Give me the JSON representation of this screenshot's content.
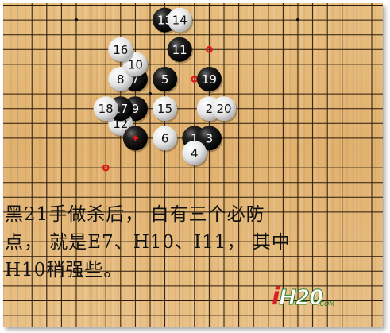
{
  "stones": [
    {
      "num": "1",
      "color": "black",
      "col": 13,
      "row": 9
    },
    {
      "num": "2",
      "color": "white",
      "col": 14,
      "row": 7
    },
    {
      "num": "3",
      "color": "black",
      "col": 14,
      "row": 9
    },
    {
      "num": "4",
      "color": "white",
      "col": 13,
      "row": 10
    },
    {
      "num": "5",
      "color": "black",
      "col": 11,
      "row": 5
    },
    {
      "num": "6",
      "color": "white",
      "col": 11,
      "row": 9
    },
    {
      "num": "7",
      "color": "black",
      "col": 9,
      "row": 5
    },
    {
      "num": "8",
      "color": "white",
      "col": 8,
      "row": 5
    },
    {
      "num": "9",
      "color": "black",
      "col": 9,
      "row": 7
    },
    {
      "num": "10",
      "color": "white",
      "col": 9,
      "row": 4
    },
    {
      "num": "11",
      "color": "black",
      "col": 12,
      "row": 3
    },
    {
      "num": "12",
      "color": "white",
      "col": 8,
      "row": 8
    },
    {
      "num": "13",
      "color": "black",
      "col": 11,
      "row": 1
    },
    {
      "num": "14",
      "color": "white",
      "col": 12,
      "row": 1
    },
    {
      "num": "15",
      "color": "white",
      "col": 11,
      "row": 7
    },
    {
      "num": "16",
      "color": "white",
      "col": 8,
      "row": 3
    },
    {
      "num": "17",
      "color": "black",
      "col": 8,
      "row": 7
    },
    {
      "num": "18",
      "color": "white",
      "col": 7,
      "row": 7
    },
    {
      "num": "19",
      "color": "black",
      "col": 14,
      "row": 5
    },
    {
      "num": "20",
      "color": "white",
      "col": 15,
      "row": 7
    },
    {
      "num": "",
      "color": "black",
      "col": 9,
      "row": 9,
      "last_move": true
    }
  ],
  "red_marks": [
    {
      "col": 14,
      "row": 3
    },
    {
      "col": 13,
      "row": 5
    },
    {
      "col": 7,
      "row": 11
    }
  ],
  "star_points": [
    {
      "col": 5,
      "row": 1
    },
    {
      "col": 10,
      "row": 6
    },
    {
      "col": 20,
      "row": 1
    }
  ],
  "caption": {
    "line1": "黑21手做杀后， 白有三个必防",
    "line2": "点， 就是E7、H10、I11， 其中",
    "line3": "H10稍强些。"
  },
  "logo": {
    "text": "iH20",
    "domain": ".COM"
  },
  "colors": {
    "grid": "#2a1a0a",
    "black_stone": "#111111",
    "white_stone": "#ececec",
    "red_mark": "#e01818"
  }
}
